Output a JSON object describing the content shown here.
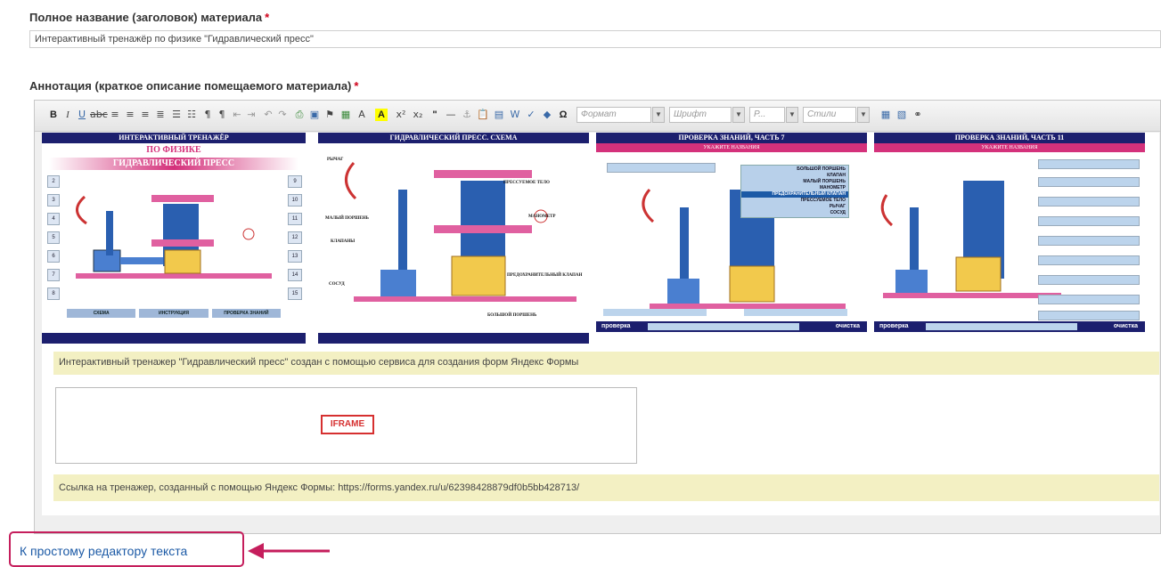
{
  "title_field": {
    "label": "Полное название (заголовок) материала",
    "required_mark": "*",
    "value": "Интерактивный тренажёр по физике \"Гидравлический пресс\""
  },
  "annotation_field": {
    "label": "Аннотация (краткое описание помещаемого материала)",
    "required_mark": "*"
  },
  "toolbar": {
    "format_placeholder": "Формат",
    "font_placeholder": "Шрифт",
    "size_placeholder": "Р...",
    "styles_placeholder": "Стили",
    "icons": [
      "bold",
      "italic",
      "underline",
      "strikethrough",
      "align-left",
      "align-center",
      "align-right",
      "justify",
      "bulleted-list",
      "numbered-list",
      "ltr",
      "rtl",
      "outdent",
      "indent",
      "undo",
      "redo",
      "print",
      "preview",
      "flag",
      "image",
      "text-color",
      "bg-color",
      "superscript",
      "subscript",
      "blockquote",
      "horizontal-rule",
      "anchor",
      "paste",
      "paste-text",
      "paste-word",
      "spellcheck",
      "eraser",
      "special-char"
    ]
  },
  "screens": [
    {
      "header": "ИНТЕРАКТИВНЫЙ ТРЕНАЖЁР",
      "heading1": "ПО ФИЗИКЕ",
      "heading2": "ГИДРАВЛИЧЕСКИЙ ПРЕСС",
      "left_numbers": [
        "2",
        "3",
        "4",
        "5",
        "6",
        "7",
        "8"
      ],
      "right_numbers": [
        "9",
        "10",
        "11",
        "12",
        "13",
        "14",
        "15"
      ],
      "buttons": [
        "СХЕМА",
        "ИНСТРУКЦИЯ",
        "ПРОВЕРКА ЗНАНИЙ"
      ]
    },
    {
      "header": "ГИДРАВЛИЧЕСКИЙ ПРЕСС. СХЕМА",
      "labels": [
        "РЫЧАГ",
        "ПРЕССУЕМОЕ ТЕЛО",
        "МАНОМЕТР",
        "МАЛЫЙ ПОРШЕНЬ",
        "КЛАПАНЫ",
        "ПРЕДОХРАНИТЕЛЬНЫЙ КЛАПАН",
        "СОСУД",
        "БОЛЬШОЙ ПОРШЕНЬ"
      ]
    },
    {
      "header": "ПРОВЕРКА ЗНАНИЙ, ЧАСТЬ 7",
      "subheader": "УКАЖИТЕ НАЗВАНИЯ",
      "options": [
        "БОЛЬШОЙ ПОРШЕНЬ",
        "КЛАПАН",
        "МАЛЫЙ ПОРШЕНЬ",
        "МАНОМЕТР",
        "ПРЕДОХРАНИТЕЛЬНЫЙ КЛАПАН",
        "ПРЕССУЕМОЕ ТЕЛО",
        "РЫЧАГ",
        "СОСУД"
      ],
      "check_button": "проверка",
      "clear_button": "очистка"
    },
    {
      "header": "ПРОВЕРКА ЗНАНИЙ, ЧАСТЬ 11",
      "subheader": "УКАЖИТЕ НАЗВАНИЯ",
      "check_button": "проверка",
      "clear_button": "очистка"
    }
  ],
  "description_text": "Интерактивный тренажер \"Гидравлический пресс\" создан с помощью сервиса для создания форм Яндекс Формы",
  "iframe_label": "IFRAME",
  "link_text": "Ссылка на тренажер, созданный с помощью Яндекс Формы: https://forms.yandex.ru/u/62398428879df0b5bb428713/",
  "simple_editor_link": "К простому редактору текста",
  "colors": {
    "screen_header": "#1c1f6e",
    "screen_accent": "#d4317b",
    "required": "#d0021b",
    "highlight_box": "#c51e5c",
    "link": "#1c5aa6",
    "note_bg": "#f3f0c3"
  }
}
